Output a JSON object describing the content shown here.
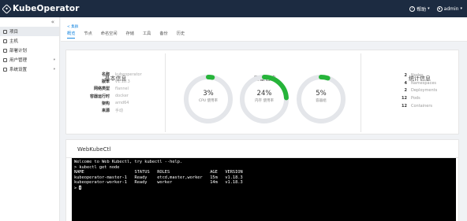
{
  "header": {
    "logo_text": "KubeOperator",
    "help_label": "帮助",
    "user_label": "admin"
  },
  "sidebar": {
    "collapse_icon": "«",
    "items": [
      {
        "label": "项目",
        "active": true
      },
      {
        "label": "主机",
        "active": false
      },
      {
        "label": "部署计划",
        "active": false
      },
      {
        "label": "用户管理",
        "active": false
      },
      {
        "label": "系统设置",
        "active": false
      }
    ]
  },
  "page": {
    "back_label": "< 集群",
    "tabs": [
      "概览",
      "节点",
      "命名空间",
      "存储",
      "工具",
      "备份",
      "历史"
    ],
    "active_tab": "概览"
  },
  "basic_info": {
    "title": "基本信息",
    "rows": [
      {
        "key": "名称",
        "value": "kubeoperator"
      },
      {
        "key": "版本",
        "value": "v1.18.3"
      },
      {
        "key": "网络类型",
        "value": "flannel"
      },
      {
        "key": "容器运行时",
        "value": "docker"
      },
      {
        "key": "架构",
        "value": "amd64"
      },
      {
        "key": "来源",
        "value": "手动"
      }
    ]
  },
  "capacity": {
    "title": "容量信息",
    "gauges": [
      {
        "percent": 3,
        "label_pct": "3%",
        "label": "CPU 使用率"
      },
      {
        "percent": 24,
        "label_pct": "24%",
        "label": "内存 使用率"
      },
      {
        "percent": 5,
        "label_pct": "5%",
        "label": "容器组"
      }
    ],
    "colors": {
      "track": "#e4e6ea",
      "fill": "#26b43a"
    }
  },
  "stats": {
    "title": "统计信息",
    "rows": [
      {
        "n": "2",
        "label": "Nodes"
      },
      {
        "n": "4",
        "label": "Namespaces"
      },
      {
        "n": "2",
        "label": "Deployments"
      },
      {
        "n": "12",
        "label": "Pods"
      },
      {
        "n": "12",
        "label": "Containers"
      }
    ]
  },
  "webkubectl": {
    "title": "WebKubeCtl",
    "lines": [
      "Welcome to Web Kubectl, try kubectl --help.",
      "> kubectl get node",
      "NAME                    STATUS   ROLES                AGE   VERSION",
      "kubeoperator-master-1   Ready    etcd,master,worker   15m   v1.18.3",
      "kubeoperator-worker-1   Ready    worker               14m   v1.18.3",
      "> "
    ]
  }
}
